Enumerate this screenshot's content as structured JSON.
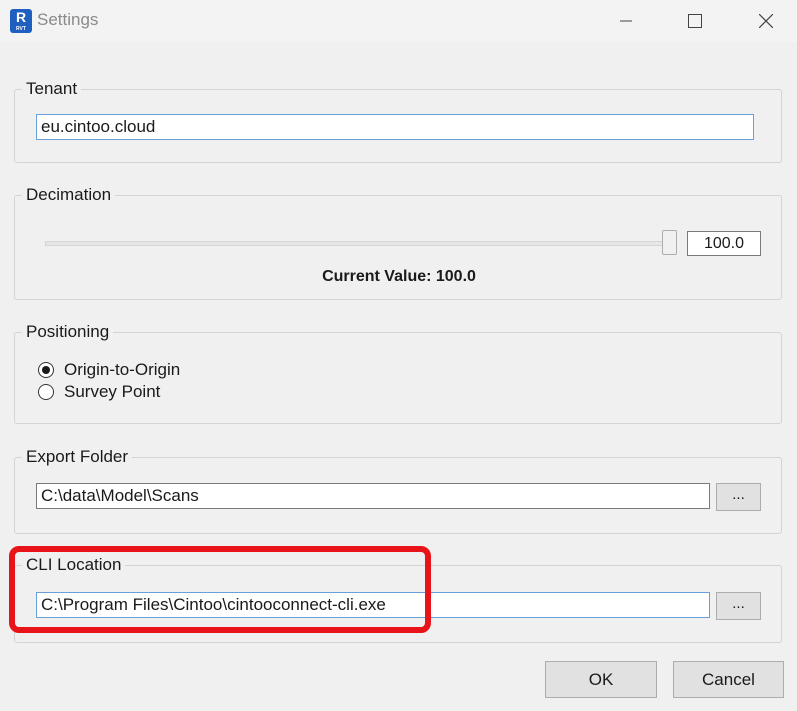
{
  "window": {
    "title": "Settings",
    "app_icon_letter": "R",
    "app_icon_sub": "RVT"
  },
  "tenant": {
    "label": "Tenant",
    "value": "eu.cintoo.cloud"
  },
  "decimation": {
    "label": "Decimation",
    "slider_value": "100.0",
    "slider_level_percent": 100,
    "current_value_text": "Current Value: 100.0"
  },
  "positioning": {
    "label": "Positioning",
    "options": [
      "Origin-to-Origin",
      "Survey Point"
    ],
    "selected": "Origin-to-Origin"
  },
  "export_folder": {
    "label": "Export Folder",
    "value": "C:\\data\\Model\\Scans",
    "browse_label": "..."
  },
  "cli_location": {
    "label": "CLI Location",
    "value": "C:\\Program Files\\Cintoo\\cintooconnect-cli.exe",
    "browse_label": "..."
  },
  "buttons": {
    "ok": "OK",
    "cancel": "Cancel"
  },
  "colors": {
    "highlight": "#e8141a",
    "app_icon": "#1f5fbf",
    "focus_border": "#6aa0d9"
  }
}
